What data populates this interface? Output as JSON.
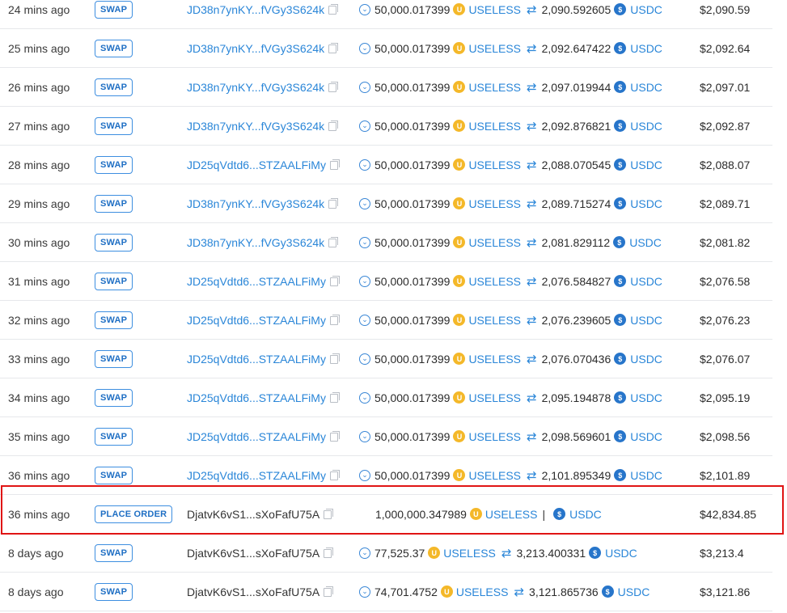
{
  "rows": [
    {
      "time": "24 mins ago",
      "type": "SWAP",
      "account": "JD38n7ynKY...fVGy3S624k",
      "account_link": true,
      "amount_in": "50,000.017399",
      "token_in": "USELESS",
      "amount_out": "2,090.592605",
      "token_out": "USDC",
      "value": "$2,090.59"
    },
    {
      "time": "25 mins ago",
      "type": "SWAP",
      "account": "JD38n7ynKY...fVGy3S624k",
      "account_link": true,
      "amount_in": "50,000.017399",
      "token_in": "USELESS",
      "amount_out": "2,092.647422",
      "token_out": "USDC",
      "value": "$2,092.64"
    },
    {
      "time": "26 mins ago",
      "type": "SWAP",
      "account": "JD38n7ynKY...fVGy3S624k",
      "account_link": true,
      "amount_in": "50,000.017399",
      "token_in": "USELESS",
      "amount_out": "2,097.019944",
      "token_out": "USDC",
      "value": "$2,097.01"
    },
    {
      "time": "27 mins ago",
      "type": "SWAP",
      "account": "JD38n7ynKY...fVGy3S624k",
      "account_link": true,
      "amount_in": "50,000.017399",
      "token_in": "USELESS",
      "amount_out": "2,092.876821",
      "token_out": "USDC",
      "value": "$2,092.87"
    },
    {
      "time": "28 mins ago",
      "type": "SWAP",
      "account": "JD25qVdtd6...STZAALFiMy",
      "account_link": true,
      "amount_in": "50,000.017399",
      "token_in": "USELESS",
      "amount_out": "2,088.070545",
      "token_out": "USDC",
      "value": "$2,088.07"
    },
    {
      "time": "29 mins ago",
      "type": "SWAP",
      "account": "JD38n7ynKY...fVGy3S624k",
      "account_link": true,
      "amount_in": "50,000.017399",
      "token_in": "USELESS",
      "amount_out": "2,089.715274",
      "token_out": "USDC",
      "value": "$2,089.71"
    },
    {
      "time": "30 mins ago",
      "type": "SWAP",
      "account": "JD38n7ynKY...fVGy3S624k",
      "account_link": true,
      "amount_in": "50,000.017399",
      "token_in": "USELESS",
      "amount_out": "2,081.829112",
      "token_out": "USDC",
      "value": "$2,081.82"
    },
    {
      "time": "31 mins ago",
      "type": "SWAP",
      "account": "JD25qVdtd6...STZAALFiMy",
      "account_link": true,
      "amount_in": "50,000.017399",
      "token_in": "USELESS",
      "amount_out": "2,076.584827",
      "token_out": "USDC",
      "value": "$2,076.58"
    },
    {
      "time": "32 mins ago",
      "type": "SWAP",
      "account": "JD25qVdtd6...STZAALFiMy",
      "account_link": true,
      "amount_in": "50,000.017399",
      "token_in": "USELESS",
      "amount_out": "2,076.239605",
      "token_out": "USDC",
      "value": "$2,076.23"
    },
    {
      "time": "33 mins ago",
      "type": "SWAP",
      "account": "JD25qVdtd6...STZAALFiMy",
      "account_link": true,
      "amount_in": "50,000.017399",
      "token_in": "USELESS",
      "amount_out": "2,076.070436",
      "token_out": "USDC",
      "value": "$2,076.07"
    },
    {
      "time": "34 mins ago",
      "type": "SWAP",
      "account": "JD25qVdtd6...STZAALFiMy",
      "account_link": true,
      "amount_in": "50,000.017399",
      "token_in": "USELESS",
      "amount_out": "2,095.194878",
      "token_out": "USDC",
      "value": "$2,095.19"
    },
    {
      "time": "35 mins ago",
      "type": "SWAP",
      "account": "JD25qVdtd6...STZAALFiMy",
      "account_link": true,
      "amount_in": "50,000.017399",
      "token_in": "USELESS",
      "amount_out": "2,098.569601",
      "token_out": "USDC",
      "value": "$2,098.56"
    },
    {
      "time": "36 mins ago",
      "type": "SWAP",
      "account": "JD25qVdtd6...STZAALFiMy",
      "account_link": true,
      "amount_in": "50,000.017399",
      "token_in": "USELESS",
      "amount_out": "2,101.895349",
      "token_out": "USDC",
      "value": "$2,101.89"
    },
    {
      "time": "36 mins ago",
      "type": "PLACE ORDER",
      "account": "DjatvK6vS1...sXoFafU75A",
      "account_link": false,
      "amount_in": "1,000,000.347989",
      "token_in": "USELESS",
      "amount_out": "",
      "token_out": "USDC",
      "value": "$42,834.85",
      "highlighted": true
    },
    {
      "time": "8 days ago",
      "type": "SWAP",
      "account": "DjatvK6vS1...sXoFafU75A",
      "account_link": false,
      "amount_in": "77,525.37",
      "token_in": "USELESS",
      "amount_out": "3,213.400331",
      "token_out": "USDC",
      "value": "$3,213.4"
    },
    {
      "time": "8 days ago",
      "type": "SWAP",
      "account": "DjatvK6vS1...sXoFafU75A",
      "account_link": false,
      "amount_in": "74,701.4752",
      "token_in": "USELESS",
      "amount_out": "3,121.865736",
      "token_out": "USDC",
      "value": "$3,121.86"
    }
  ],
  "icons": {
    "direction": "chevron-circle-down-icon",
    "swap": "swap-arrows-icon",
    "copy": "copy-icon",
    "useless_token": "useless-token-icon",
    "usdc_token": "usdc-token-icon"
  },
  "colors": {
    "link": "#2a86d8",
    "badge_border": "#3d8ee0",
    "highlight": "#e01414",
    "useless_token": "#f4b829",
    "usdc_token": "#2775ca"
  },
  "separator": "|"
}
